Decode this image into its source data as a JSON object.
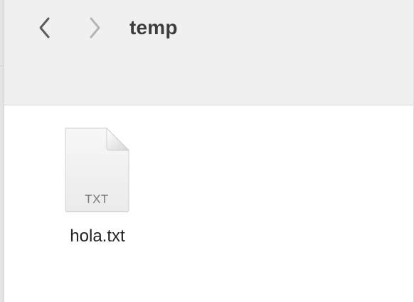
{
  "window": {
    "title": "temp"
  },
  "toolbar": {
    "back_icon": "chevron-left-icon",
    "forward_icon": "chevron-right-icon"
  },
  "files": [
    {
      "name": "hola.txt",
      "extension_label": "TXT",
      "icon": "text-document-icon"
    }
  ],
  "colors": {
    "toolbar_bg": "#f0f0f0",
    "content_bg": "#ffffff",
    "title_text": "#3d3d3d",
    "back_enabled": "#5c5c5c",
    "forward_disabled": "#b5b5b5"
  }
}
